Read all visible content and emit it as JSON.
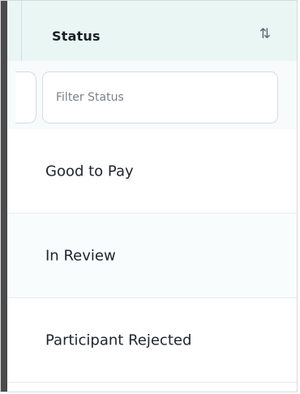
{
  "table": {
    "column": {
      "header": "Status",
      "sort_icon": "sort-icon"
    },
    "filter": {
      "placeholder": "Filter Status",
      "value": ""
    },
    "rows": [
      {
        "status": "Good to Pay"
      },
      {
        "status": "In Review"
      },
      {
        "status": "Participant Rejected"
      }
    ]
  },
  "colors": {
    "header_background": "#e9f6f4",
    "row_border": "#e7ebee",
    "input_border": "#d7dbe0",
    "text": "#20262d",
    "muted_text": "#7b8189"
  }
}
